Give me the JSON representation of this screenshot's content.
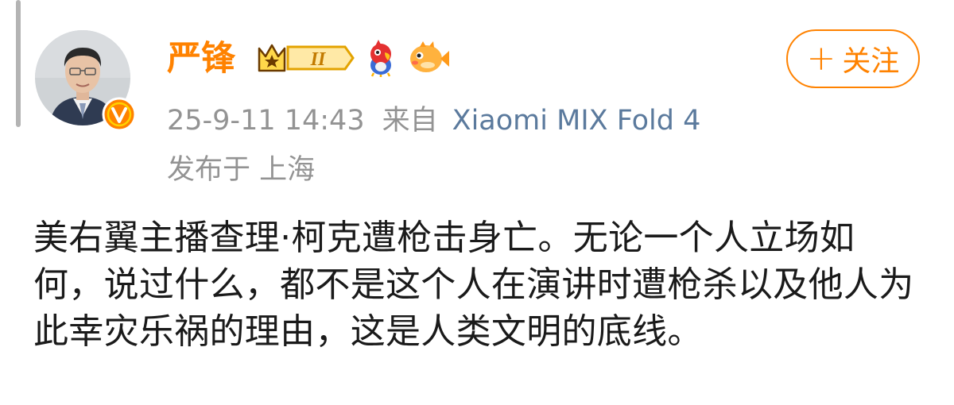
{
  "post": {
    "username": "严锋",
    "level_badge": "II",
    "timestamp": "25-9-11 14:43",
    "from_label": "来自",
    "source": "Xiaomi MIX Fold 4",
    "location": "发布于 上海",
    "content": "美右翼主播查理·柯克遭枪击身亡。无论一个人立场如何，说过什么，都不是这个人在演讲时遭枪杀以及他人为此幸灾乐祸的理由，这是人类文明的底线。"
  },
  "follow_button": {
    "plus": "+",
    "label": "关注"
  },
  "colors": {
    "accent": "#ff8200",
    "meta_gray": "#939393",
    "source_blue": "#5b7a9d",
    "text": "#1a1a1a"
  },
  "icons": [
    "avatar",
    "verified-v-icon",
    "crown-level-badge-icon",
    "parrot-icon",
    "pufferfish-icon"
  ]
}
